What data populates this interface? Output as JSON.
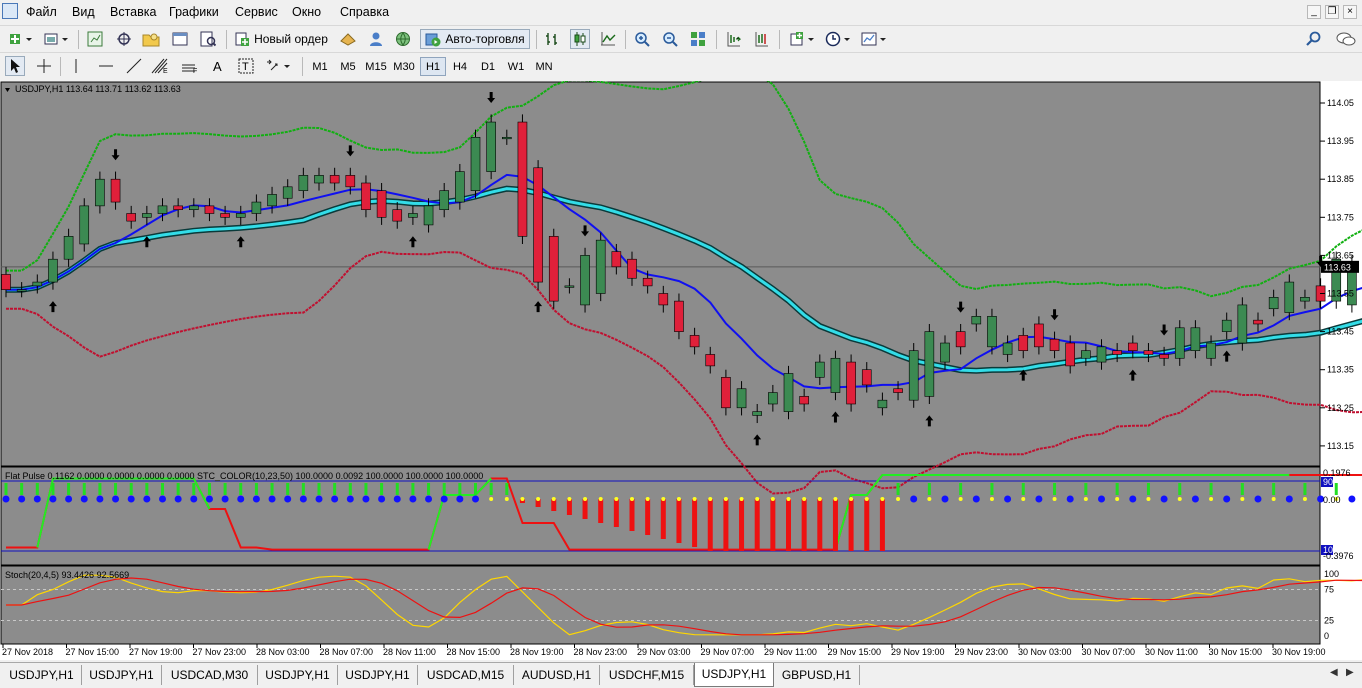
{
  "menu": {
    "items": [
      "Файл",
      "Вид",
      "Вставка",
      "Графики",
      "Сервис",
      "Окно",
      "Справка"
    ]
  },
  "toolbar": {
    "new_order_label": "Новый ордер",
    "autotrading_label": "Авто-торговля",
    "timeframes": [
      "M1",
      "M5",
      "M15",
      "M30",
      "H1",
      "H4",
      "D1",
      "W1",
      "MN"
    ],
    "active_timeframe": "H1"
  },
  "chart": {
    "header": "USDJPY,H1  113.64 113.71 113.62 113.63",
    "current_price_label": "113.63",
    "price_axis_labels": [
      "114.05",
      "113.95",
      "113.85",
      "113.75",
      "113.65",
      "113.55",
      "113.45",
      "113.35",
      "113.25",
      "113.15"
    ],
    "time_axis_labels": [
      "27 Nov 2018",
      "27 Nov 15:00",
      "27 Nov 19:00",
      "27 Nov 23:00",
      "28 Nov 03:00",
      "28 Nov 07:00",
      "28 Nov 11:00",
      "28 Nov 15:00",
      "28 Nov 19:00",
      "28 Nov 23:00",
      "29 Nov 03:00",
      "29 Nov 07:00",
      "29 Nov 11:00",
      "29 Nov 15:00",
      "29 Nov 19:00",
      "29 Nov 23:00",
      "30 Nov 03:00",
      "30 Nov 07:00",
      "30 Nov 11:00",
      "30 Nov 15:00",
      "30 Nov 19:00"
    ],
    "colors": {
      "background": "#8c8c8c",
      "bull_candle": "#3c8a52",
      "bear_candle": "#e0203a",
      "ma_fast": "#1010f0",
      "ma_slow": "#33dde8",
      "band_upper": "#11b011",
      "band_lower": "#c01030"
    }
  },
  "flat_pulse": {
    "header": "Flat Pulse 0.1162 0.0000 0.0000 0.0000 0.0000  STC_COLOR(10,23,50) 100.0000 0.0092 100.0000 100.0000 100.0000",
    "axis_labels": [
      "0.1976",
      "90",
      "0.00",
      "10",
      "-0.3976"
    ]
  },
  "stoch": {
    "header": "Stoch(20,4,5) 93.4426 92.5669",
    "axis_labels": [
      "100",
      "75",
      "25",
      "0"
    ]
  },
  "tabs": [
    "USDJPY,H1",
    "USDJPY,H1",
    "USDCAD,M30",
    "USDJPY,H1",
    "USDJPY,H1",
    "USDCAD,M15",
    "AUDUSD,H1",
    "USDCHF,M15",
    "USDJPY,H1",
    "GBPUSD,H1"
  ],
  "active_tab_index": 8,
  "chart_data": {
    "type": "candlestick",
    "symbol": "USDJPY,H1",
    "ylim": [
      113.1,
      114.1
    ],
    "open": [
      113.6,
      113.56,
      113.57,
      113.58,
      113.64,
      113.68,
      113.78,
      113.85,
      113.76,
      113.75,
      113.76,
      113.78,
      113.77,
      113.78,
      113.76,
      113.75,
      113.76,
      113.78,
      113.8,
      113.82,
      113.84,
      113.86,
      113.86,
      113.84,
      113.82,
      113.77,
      113.75,
      113.73,
      113.77,
      113.79,
      113.82,
      113.87,
      113.96,
      114.0,
      113.88,
      113.7,
      113.57,
      113.52,
      113.55,
      113.66,
      113.64,
      113.59,
      113.55,
      113.53,
      113.44,
      113.39,
      113.33,
      113.25,
      113.23,
      113.26,
      113.24,
      113.28,
      113.33,
      113.29,
      113.37,
      113.35,
      113.25,
      113.3,
      113.27,
      113.28,
      113.37,
      113.45,
      113.47,
      113.41,
      113.39,
      113.44,
      113.47,
      113.43,
      113.42,
      113.38,
      113.37,
      113.4,
      113.42,
      113.4,
      113.39,
      113.38,
      113.4,
      113.38,
      113.45,
      113.42,
      113.48,
      113.51,
      113.5,
      113.53,
      113.57,
      113.53,
      113.52,
      113.63
    ],
    "close": [
      113.56,
      113.56,
      113.58,
      113.64,
      113.7,
      113.78,
      113.85,
      113.79,
      113.74,
      113.76,
      113.78,
      113.77,
      113.78,
      113.76,
      113.75,
      113.76,
      113.79,
      113.81,
      113.83,
      113.86,
      113.86,
      113.84,
      113.83,
      113.77,
      113.75,
      113.74,
      113.76,
      113.78,
      113.82,
      113.87,
      113.96,
      114.0,
      113.96,
      113.7,
      113.58,
      113.53,
      113.57,
      113.65,
      113.69,
      113.62,
      113.59,
      113.57,
      113.52,
      113.45,
      113.41,
      113.36,
      113.25,
      113.3,
      113.24,
      113.29,
      113.34,
      113.26,
      113.37,
      113.38,
      113.26,
      113.31,
      113.27,
      113.29,
      113.4,
      113.45,
      113.42,
      113.41,
      113.49,
      113.49,
      113.42,
      113.4,
      113.41,
      113.4,
      113.36,
      113.4,
      113.41,
      113.39,
      113.4,
      113.39,
      113.38,
      113.46,
      113.46,
      113.42,
      113.48,
      113.52,
      113.47,
      113.54,
      113.58,
      113.54,
      113.53,
      113.64,
      113.63,
      113.62
    ]
  }
}
